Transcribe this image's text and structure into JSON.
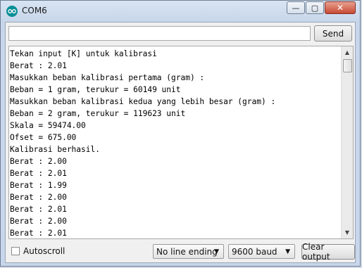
{
  "window": {
    "title": "COM6"
  },
  "controls": {
    "minimize": "—",
    "maximize": "▢",
    "close": "✕"
  },
  "send": {
    "input_value": "",
    "button_label": "Send"
  },
  "output": {
    "lines": [
      "Tekan input [K] untuk kalibrasi",
      "Berat : 2.01",
      "Masukkan beban kalibrasi pertama (gram) :",
      "Beban = 1 gram, terukur = 60149 unit",
      "Masukkan beban kalibrasi kedua yang lebih besar (gram) :",
      "Beban = 2 gram, terukur = 119623 unit",
      "Skala = 59474.00",
      "Ofset = 675.00",
      "Kalibrasi berhasil.",
      "Berat : 2.00",
      "Berat : 2.01",
      "Berat : 1.99",
      "Berat : 2.00",
      "Berat : 2.01",
      "Berat : 2.00",
      "Berat : 2.01"
    ]
  },
  "footer": {
    "autoscroll_label": "Autoscroll",
    "autoscroll_checked": false,
    "line_ending": "No line ending",
    "baud_rate": "9600 baud",
    "clear_label": "Clear output"
  },
  "icons": {
    "app": "arduino-infinity-icon",
    "scroll_up": "chevron-up-icon",
    "scroll_down": "chevron-down-icon",
    "dropdown": "caret-down-icon"
  }
}
